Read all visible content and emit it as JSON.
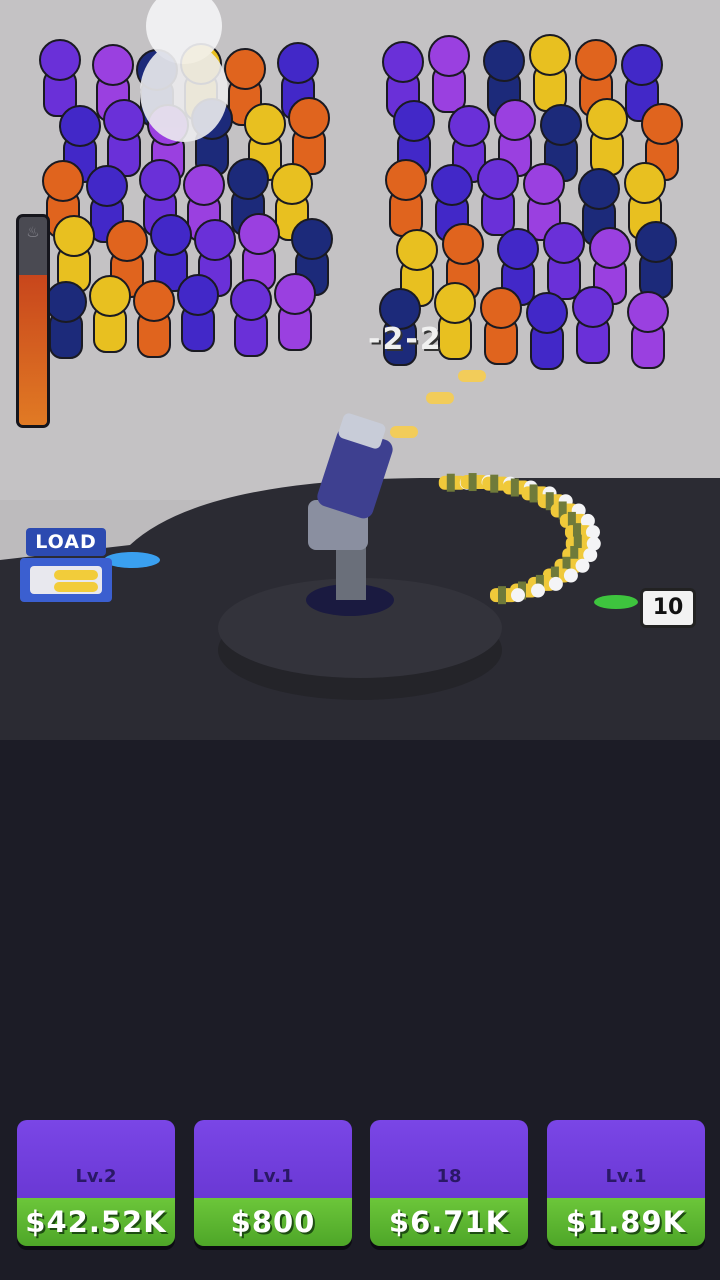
{
  "hud": {
    "heat_meter": {
      "level": 0.72,
      "icon": "flame-icon"
    },
    "load_station": {
      "label": "LOAD"
    },
    "ammo_counter": {
      "value": "10"
    },
    "damage_popup": {
      "text": "-2-2"
    }
  },
  "upgrades": [
    {
      "level": "Lv.2",
      "price": "$42.52K"
    },
    {
      "level": "Lv.1",
      "price": "$800"
    },
    {
      "level": "18",
      "price": "$6.71K"
    },
    {
      "level": "Lv.1",
      "price": "$1.89K"
    }
  ],
  "colors": {
    "floor": "#c2c0c2",
    "platform": "#2a2a32",
    "upgrade_top": "#6e3edc",
    "upgrade_price": "#5cb833",
    "heat_fill": "#d8601e",
    "crowd": [
      "#6a30d8",
      "#4228c8",
      "#e0641e",
      "#e8c020",
      "#1c2a7a",
      "#9a40e0"
    ]
  }
}
